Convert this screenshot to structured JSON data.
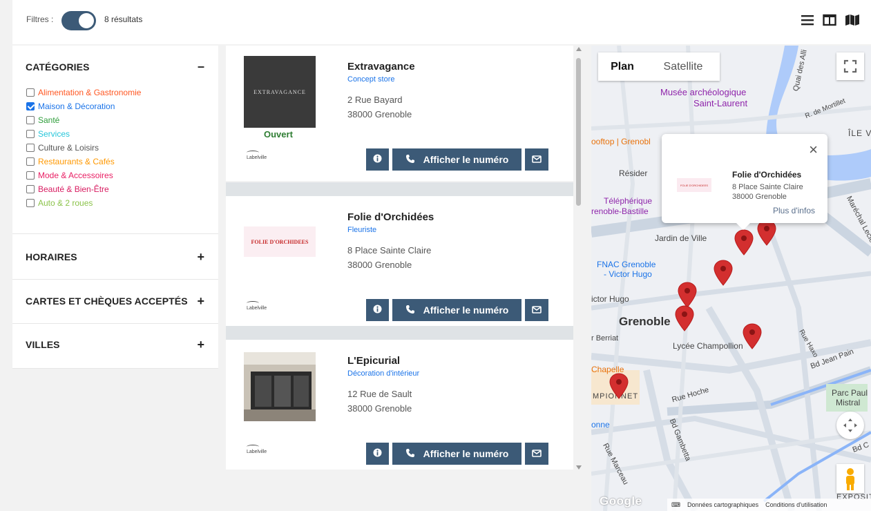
{
  "toolbar": {
    "filters_label": "Filtres :",
    "results_count": "8 résultats",
    "view_icons": [
      "list-view-icon",
      "split-view-icon",
      "map-view-icon"
    ]
  },
  "sidebar": {
    "categories": {
      "title": "CATÉGORIES",
      "toggle": "–",
      "items": [
        {
          "label": "Alimentation & Gastronomie",
          "color": "#ff5722",
          "checked": false
        },
        {
          "label": "Maison & Décoration",
          "color": "#1a73e8",
          "checked": true
        },
        {
          "label": "Santé",
          "color": "#2e9d3a",
          "checked": false
        },
        {
          "label": "Services",
          "color": "#26c6da",
          "checked": false
        },
        {
          "label": "Culture & Loisirs",
          "color": "#555555",
          "checked": false
        },
        {
          "label": "Restaurants & Cafés",
          "color": "#ff9800",
          "checked": false
        },
        {
          "label": "Mode & Accessoires",
          "color": "#e91e63",
          "checked": false
        },
        {
          "label": "Beauté & Bien-Être",
          "color": "#d81b60",
          "checked": false
        },
        {
          "label": "Auto & 2 roues",
          "color": "#8bc34a",
          "checked": false
        }
      ]
    },
    "horaires": {
      "title": "HORAIRES",
      "toggle": "+"
    },
    "cartes": {
      "title": "CARTES ET CHÈQUES ACCEPTÉS",
      "toggle": "+"
    },
    "villes": {
      "title": "VILLES",
      "toggle": "+"
    }
  },
  "listings": [
    {
      "name": "Extravagance",
      "category": "Concept store",
      "address1": "2 Rue Bayard",
      "address2": "38000 Grenoble",
      "status": "Ouvert",
      "thumb_text": "EXTRAVAGANCE",
      "brand": "Labelville",
      "phone_label": "Afficher le numéro"
    },
    {
      "name": "Folie d'Orchidées",
      "category": "Fleuriste",
      "address1": "8 Place Sainte Claire",
      "address2": "38000 Grenoble",
      "thumb_text": "FOLIE D'ORCHIDEES",
      "brand": "Labelville",
      "phone_label": "Afficher le numéro"
    },
    {
      "name": "L'Epicurial",
      "category": "Décoration d'intérieur",
      "address1": "12 Rue de Sault",
      "address2": "38000 Grenoble",
      "brand": "Labelville",
      "phone_label": "Afficher le numéro"
    }
  ],
  "map": {
    "tab_plan": "Plan",
    "tab_satellite": "Satellite",
    "popup": {
      "name": "Folie d'Orchidées",
      "address1": "8 Place Sainte Claire",
      "address2": "38000 Grenoble",
      "more": "Plus d'infos",
      "close": "×",
      "logo_text": "FOLIE D'ORCHIDEES"
    },
    "labels": {
      "musee1": "Musée archéologique",
      "musee2": "Saint-Laurent",
      "quai": "Quai des Alli",
      "mortillet": "R. de Mortillet",
      "ile": "ÎLE V",
      "rooftop": "ooftop | Grenobl",
      "residence": "Résider",
      "telepherique1": "Téléphérique",
      "telepherique2": "renoble-Bastille",
      "jardin": "Jardin de Ville",
      "fnac1": "FNAC Grenoble",
      "fnac2": "- Victor Hugo",
      "victor": "ictor Hugo",
      "grenoble": "Grenoble",
      "berriat": "r Berriat",
      "lycee": "Lycée Champollion",
      "chapelle": "Chapelle",
      "championnet": "MPIONNET",
      "hoche": "Rue Hoche",
      "gambetta": "Bd Gambetta",
      "jeanpain": "Bd Jean Pain",
      "marechal": "Maréchal Leclerc",
      "haxo": "Rue Haxo",
      "parc1": "Parc Paul",
      "parc2": "Mistral",
      "bd": "Bd C",
      "marceau": "Rue Marceau",
      "onne": "onne",
      "exposit": "EXPOSIT",
      "google": "Google",
      "donnees": "Données cartographiques",
      "conditions": "Conditions d'utilisation"
    },
    "pin_color": "#d32f2f"
  }
}
